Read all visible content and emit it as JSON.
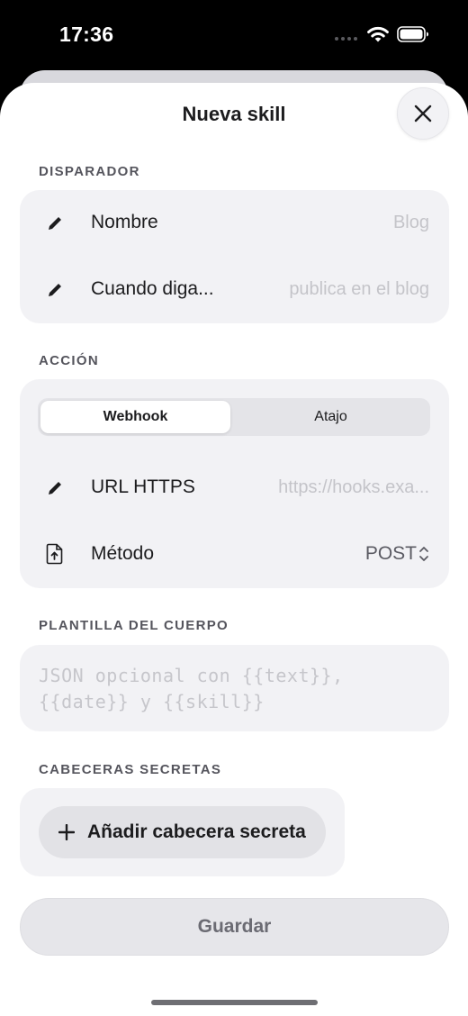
{
  "status": {
    "time": "17:36"
  },
  "sheet": {
    "title": "Nueva skill"
  },
  "trigger": {
    "header": "DISPARADOR",
    "name_label": "Nombre",
    "name_placeholder": "Blog",
    "phrase_label": "Cuando diga...",
    "phrase_placeholder": "publica en el blog"
  },
  "action": {
    "header": "ACCIÓN",
    "segments": [
      "Webhook",
      "Atajo"
    ],
    "selected_segment": "Webhook",
    "url_label": "URL HTTPS",
    "url_placeholder": "https://hooks.exa...",
    "method_label": "Método",
    "method_value": "POST"
  },
  "body_template": {
    "header": "PLANTILLA DEL CUERPO",
    "placeholder": "JSON opcional con {{text}},\n{{date}} y {{skill}}"
  },
  "secret_headers": {
    "header": "CABECERAS SECRETAS",
    "add_label": "Añadir cabecera secreta"
  },
  "footer": {
    "save_label": "Guardar"
  },
  "icons": {
    "close": "xmark-icon",
    "edit": "pencil-icon",
    "method": "document-upload-icon",
    "chevron": "chevron-up-down-icon",
    "add": "plus-icon"
  },
  "colors": {
    "sheet_background": "#ffffff",
    "card_background": "#f2f2f5",
    "placeholder": "#c4c4c9",
    "primary_text": "#1c1c1e"
  }
}
